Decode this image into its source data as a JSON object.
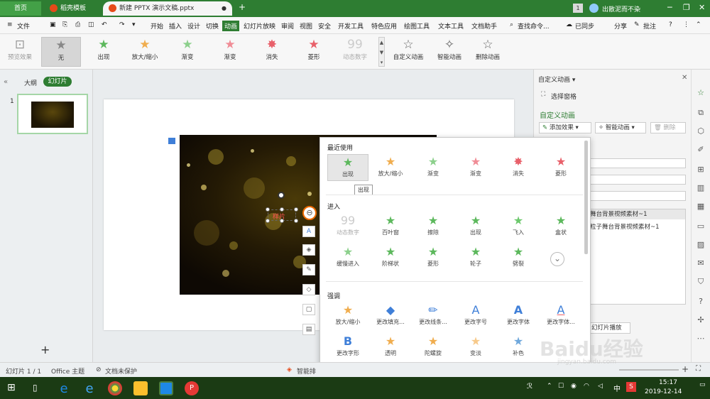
{
  "titlebar": {
    "home": "首页",
    "tabs": [
      "稻壳模板",
      "新建 PPTX 演示文稿.pptx"
    ],
    "add": "+",
    "badge": "1",
    "user": "出散泥而不染",
    "min": "─",
    "max": "❐",
    "close": "✕"
  },
  "menubar": {
    "file": "文件",
    "items": [
      "开始",
      "插入",
      "设计",
      "切换",
      "动画",
      "幻灯片放映",
      "审阅",
      "视图",
      "安全",
      "开发工具",
      "特色应用",
      "绘图工具",
      "文本工具",
      "文档助手"
    ],
    "active": "动画",
    "search": "查找命令...",
    "sync": "已同步",
    "share": "分享",
    "comment": "批注",
    "help": "?"
  },
  "ribbon": {
    "preview": "预览效果",
    "items": [
      "无",
      "出现",
      "放大/缩小",
      "渐变",
      "渐变",
      "消失",
      "菱形",
      "动态数字"
    ],
    "custom": "自定义动画",
    "smart": "智能动画",
    "delete": "删除动画"
  },
  "leftpanel": {
    "outline": "大纲",
    "slides": "幻灯片",
    "slide_no": "1",
    "add": "+"
  },
  "slide": {
    "text": "样片"
  },
  "popup": {
    "recent_title": "最近使用",
    "recent": [
      "出现",
      "放大/缩小",
      "渐变",
      "渐变",
      "消失",
      "菱形"
    ],
    "tooltip": "出现",
    "enter_title": "进入",
    "enter_row1": [
      "动态数字",
      "百叶窗",
      "擦除",
      "出现",
      "飞入",
      "盒状"
    ],
    "enter_row2": [
      "缓慢进入",
      "阶梯状",
      "菱形",
      "轮子",
      "劈裂"
    ],
    "emph_title": "强调",
    "emph_row1": [
      "放大/缩小",
      "更改填充...",
      "更改线条...",
      "更改字号",
      "更改字体",
      "更改字体..."
    ],
    "emph_row2": [
      "更改字形",
      "透明",
      "陀螺旋",
      "变淡",
      "补色"
    ],
    "more": "⌄"
  },
  "rightpanel": {
    "title": "自定义动画",
    "select_pane": "选择窗格",
    "subtitle": "自定义动画",
    "add_effect": "添加效果",
    "smart": "智能动画",
    "delete": "删除",
    "list1": "舞台背景视频素材~1",
    "list2": "粒子舞台背景视频素材~1",
    "play": "幻灯片播放"
  },
  "statusbar": {
    "slide": "幻灯片 1 / 1",
    "theme": "Office 主题",
    "protect": "文档未保护",
    "smart": "智能排"
  },
  "taskbar": {
    "time": "15:17",
    "date": "2019-12-14",
    "lang": "中",
    "brand": "jingyan.baidu.com"
  },
  "colors": {
    "accent": "#2e7d32",
    "star_green": "#5cb85c",
    "star_orange": "#f0ad4e",
    "star_red": "#e8606a",
    "emphasis_blue": "#3f7fd8"
  }
}
